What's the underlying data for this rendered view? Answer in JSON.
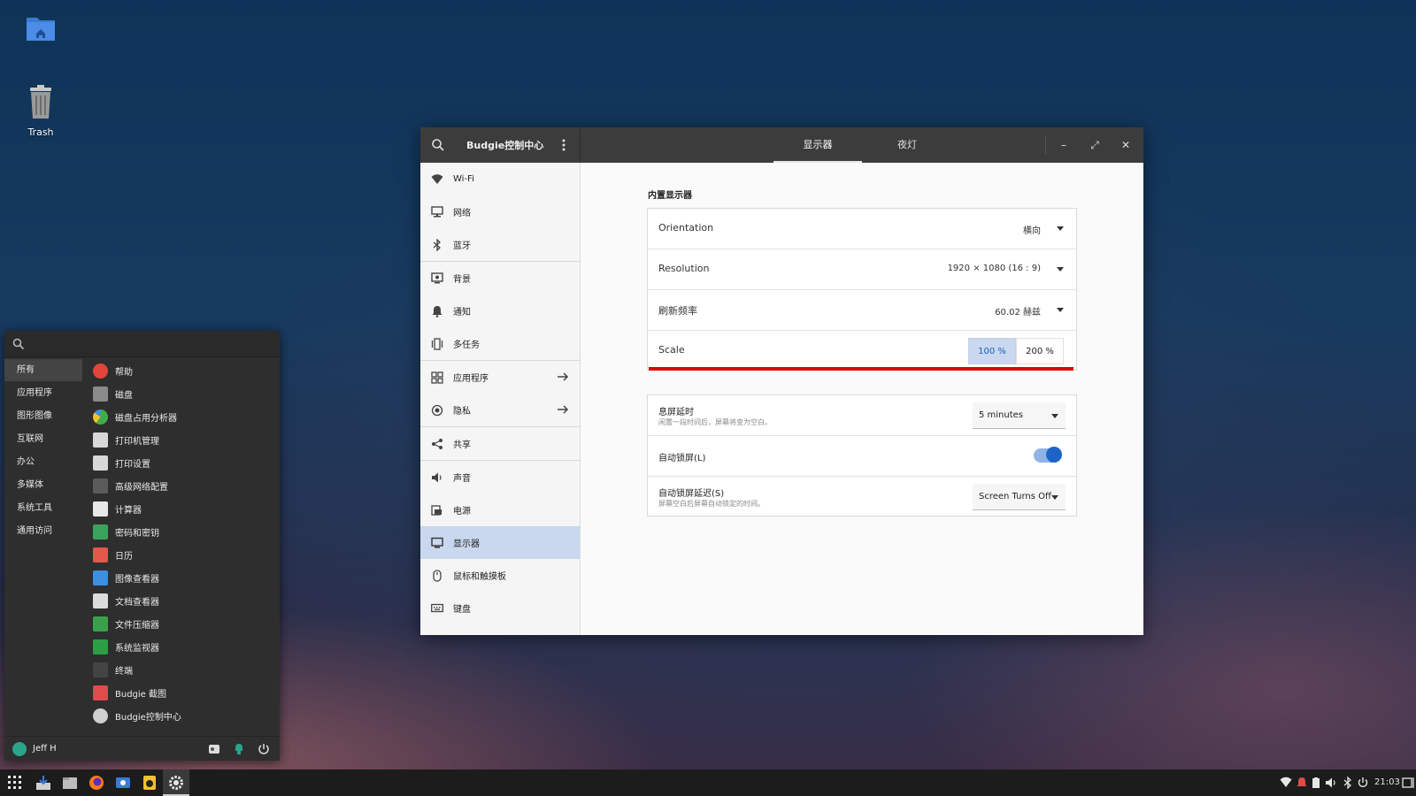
{
  "desktop": {
    "icons": [
      {
        "label": "",
        "icon": "home-folder-icon"
      },
      {
        "label": "Trash",
        "icon": "trash-icon"
      }
    ]
  },
  "window": {
    "title": "Budgie控制中心",
    "tabs": [
      {
        "label": "显示器",
        "active": true
      },
      {
        "label": "夜灯",
        "active": false
      }
    ],
    "controls": {
      "minimize": "–",
      "maximize": "⤢",
      "close": "✕"
    }
  },
  "sidebar": {
    "items": [
      {
        "label": "Wi-Fi",
        "icon": "wifi-icon"
      },
      {
        "label": "网络",
        "icon": "network-icon"
      },
      {
        "label": "蓝牙",
        "icon": "bluetooth-icon"
      },
      {
        "label": "背景",
        "icon": "background-icon"
      },
      {
        "label": "通知",
        "icon": "bell-icon"
      },
      {
        "label": "多任务",
        "icon": "multitasking-icon"
      },
      {
        "label": "应用程序",
        "icon": "apps-grid-icon",
        "arrow": true
      },
      {
        "label": "隐私",
        "icon": "privacy-icon",
        "arrow": true
      },
      {
        "label": "共享",
        "icon": "share-icon"
      },
      {
        "label": "声音",
        "icon": "speaker-icon"
      },
      {
        "label": "电源",
        "icon": "power-plug-icon"
      },
      {
        "label": "显示器",
        "icon": "monitor-icon",
        "active": true
      },
      {
        "label": "鼠标和触摸板",
        "icon": "mouse-icon"
      },
      {
        "label": "键盘",
        "icon": "keyboard-icon"
      }
    ]
  },
  "display": {
    "section_title": "内置显示器",
    "orientation": {
      "label": "Orientation",
      "value": "横向"
    },
    "resolution": {
      "label": "Resolution",
      "value": "1920 × 1080 (16 : 9)"
    },
    "refresh": {
      "label": "刷新频率",
      "value": "60.02 赫兹"
    },
    "scale": {
      "label": "Scale",
      "options": [
        "100 %",
        "200 %"
      ],
      "selected": "100 %"
    },
    "highlight_color": "#e10000"
  },
  "lock": {
    "blank": {
      "label": "息屏延时",
      "sub": "闲置一段时间后，屏幕将变为空白。",
      "value": "5 minutes"
    },
    "autolock": {
      "label": "自动锁屏(L)",
      "enabled": true
    },
    "lock_delay": {
      "label": "自动锁屏延迟(S)",
      "sub": "屏幕空白后屏幕自动锁定的时间。",
      "value": "Screen Turns Off"
    }
  },
  "start_menu": {
    "search_placeholder": "",
    "categories": [
      "所有",
      "应用程序",
      "图形图像",
      "互联网",
      "办公",
      "多媒体",
      "系统工具",
      "通用访问"
    ],
    "active_category": "所有",
    "apps": [
      {
        "label": "帮助",
        "color": "#e0463c"
      },
      {
        "label": "磁盘",
        "color": "#8a8a8a"
      },
      {
        "label": "磁盘占用分析器",
        "color": "#3fae49"
      },
      {
        "label": "打印机管理",
        "color": "#d8d8d8"
      },
      {
        "label": "打印设置",
        "color": "#d8d8d8"
      },
      {
        "label": "高级网络配置",
        "color": "#5b5b5b"
      },
      {
        "label": "计算器",
        "color": "#e8e8e8"
      },
      {
        "label": "密码和密钥",
        "color": "#3aa35b"
      },
      {
        "label": "日历",
        "color": "#e5574a"
      },
      {
        "label": "图像查看器",
        "color": "#3d8fe0"
      },
      {
        "label": "文档查看器",
        "color": "#dcdcdc"
      },
      {
        "label": "文件压缩器",
        "color": "#3aa14a"
      },
      {
        "label": "系统监视器",
        "color": "#2e9e44"
      },
      {
        "label": "终端",
        "color": "#444444"
      },
      {
        "label": "Budgie 截图",
        "color": "#e04b4b"
      },
      {
        "label": "Budgie控制中心",
        "color": "#cfcfcf"
      }
    ],
    "user": "Jeff H"
  },
  "taskbar": {
    "clock": "21:03",
    "apps": [
      "app-grid-icon",
      "downloads-icon",
      "files-icon",
      "firefox-icon",
      "screenshot-icon",
      "rhythmbox-icon",
      "settings-icon"
    ]
  }
}
